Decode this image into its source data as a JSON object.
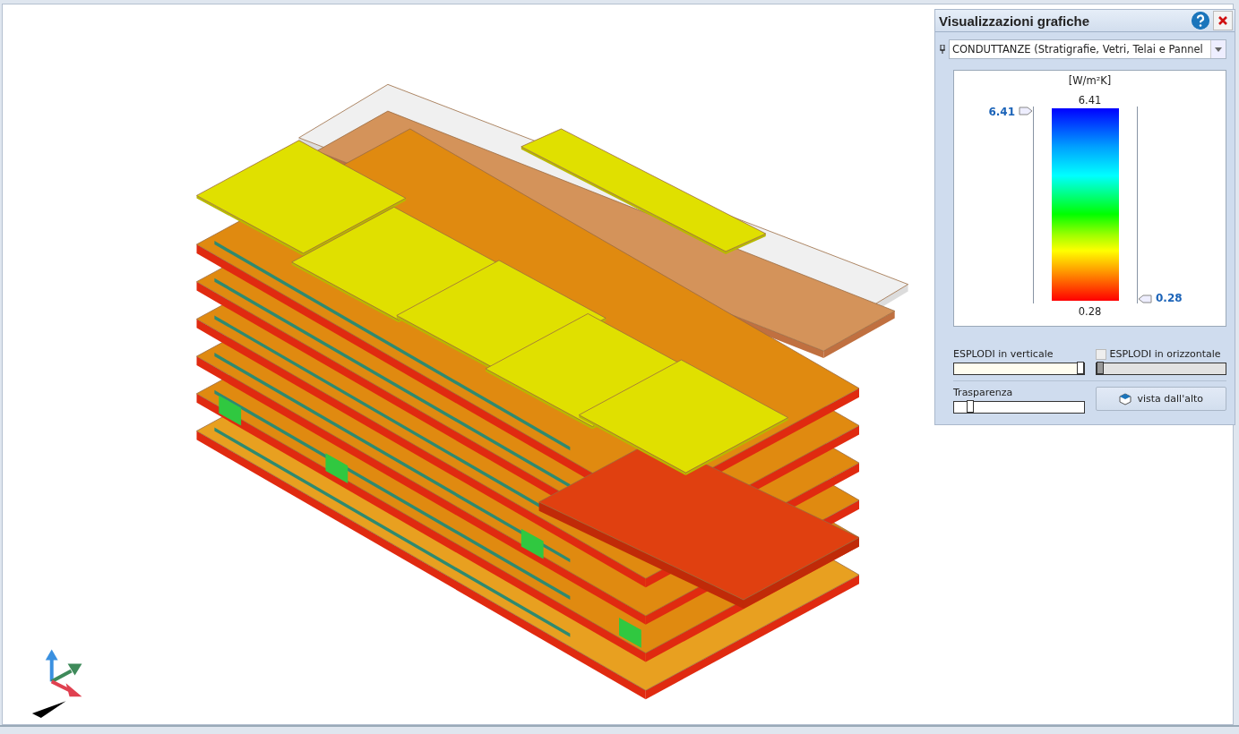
{
  "panel": {
    "title": "Visualizzazioni grafiche",
    "mode_select": {
      "value": "CONDUTTANZE (Stratigrafie, Vetri, Telai e Pannel"
    },
    "legend": {
      "unit": "[W/m²K]",
      "max_label": "6.41",
      "min_label": "0.28",
      "upper_handle": "6.41",
      "lower_handle": "0.28"
    },
    "controls": {
      "explode_vertical": {
        "label": "ESPLODI in verticale",
        "level": 1.0
      },
      "explode_horizontal": {
        "label": "ESPLODI in orizzontale",
        "checked": false,
        "level": 0.0
      },
      "transparency": {
        "label": "Trasparenza",
        "level": 0.1
      },
      "top_view_button": "vista dall'alto"
    }
  }
}
